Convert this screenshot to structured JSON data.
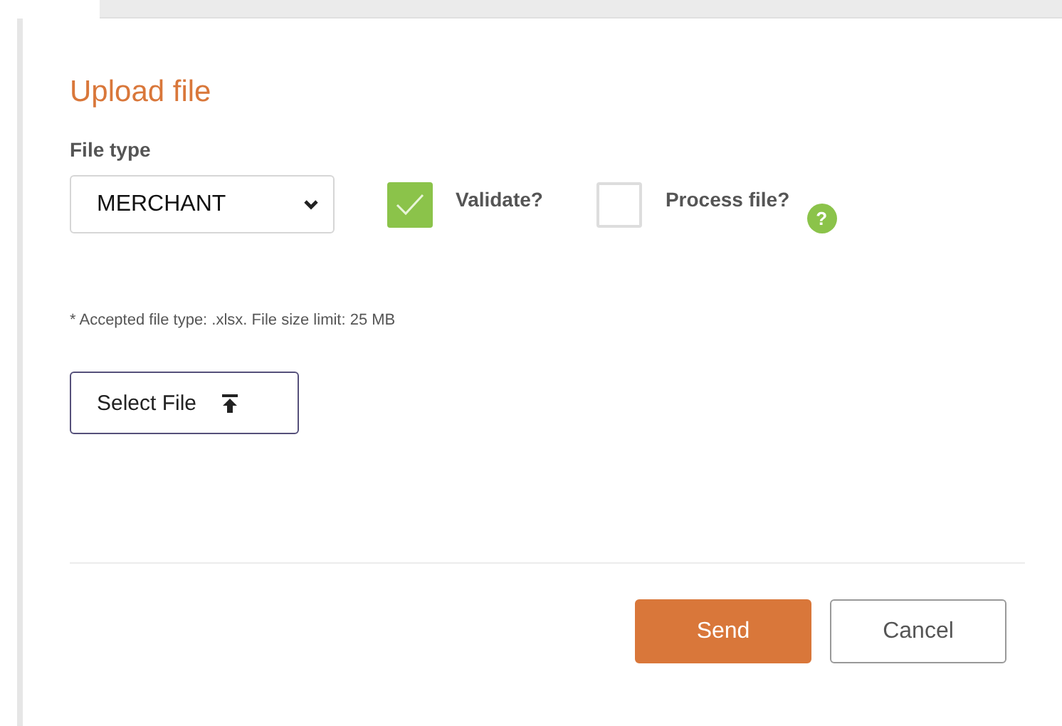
{
  "dialog": {
    "title": "Upload file",
    "file_type": {
      "label": "File type",
      "value": "MERCHANT"
    },
    "options": [
      {
        "label": "Validate?",
        "checked": true
      },
      {
        "label": "Process file?",
        "checked": false
      }
    ],
    "help_icon": "?",
    "note": "* Accepted file type: .xlsx. File size limit: 25 MB",
    "select_file_button": "Select File",
    "buttons": [
      {
        "label": "Send",
        "kind": "primary"
      },
      {
        "label": "Cancel",
        "kind": "secondary"
      }
    ]
  }
}
